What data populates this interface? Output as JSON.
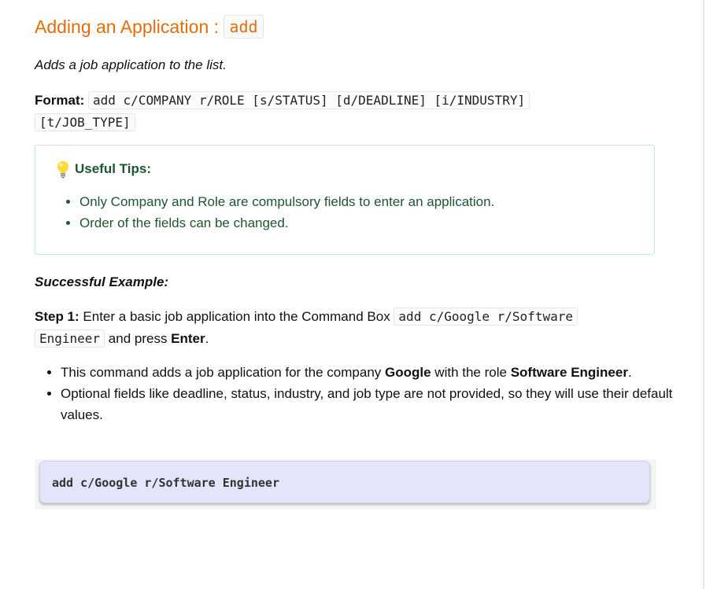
{
  "heading": {
    "text": "Adding an Application : ",
    "command": "add"
  },
  "description": "Adds a job application to the list.",
  "format": {
    "label": "Format:",
    "syntax": "add c/COMPANY r/ROLE [s/STATUS] [d/DEADLINE] [i/INDUSTRY]",
    "syntax_cont": "[t/JOB_TYPE]"
  },
  "tips": {
    "title": "Useful Tips:",
    "icon": "lightbulb-icon",
    "items": [
      "Only Company and Role are compulsory fields to enter an application.",
      "Order of the fields can be changed."
    ]
  },
  "example": {
    "heading": "Successful Example:",
    "step_label": "Step 1:",
    "step_text": " Enter a basic job application into the Command Box ",
    "step_code": "add c/Google r/Software",
    "step_code_cont": "Engineer",
    "step_end": " and press ",
    "step_key": "Enter",
    "step_period": ".",
    "bullet1": {
      "a": "This command adds a job application for the company ",
      "company": "Google",
      "b": " with the role ",
      "role": "Software Engineer",
      "c": "."
    },
    "bullet2": "Optional fields like deadline, status, industry, and job type are not provided, so they will use their default values.",
    "command_box": "add c/Google r/Software Engineer"
  },
  "colors": {
    "heading": "#e46c0a",
    "tips_text": "#1e5631",
    "tips_border": "#c8e6df",
    "command_bg": "#e4e4fa"
  }
}
